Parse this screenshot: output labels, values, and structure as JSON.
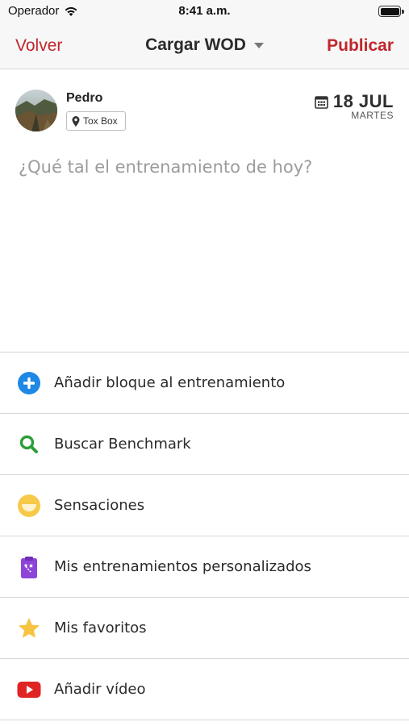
{
  "status_bar": {
    "carrier": "Operador",
    "time": "8:41 a.m."
  },
  "nav": {
    "back_label": "Volver",
    "title": "Cargar WOD",
    "publish_label": "Publicar"
  },
  "post": {
    "user_name": "Pedro",
    "place": "Tox Box",
    "date": "18 JUL",
    "weekday": "MARTES",
    "placeholder": "¿Qué tal el entrenamiento de hoy?"
  },
  "options": [
    {
      "label": "Añadir bloque al entrenamiento",
      "icon": "plus-circle-icon",
      "color": "#1e88e5"
    },
    {
      "label": "Buscar Benchmark",
      "icon": "magnifier-icon",
      "color": "#2e9e38"
    },
    {
      "label": "Sensaciones",
      "icon": "smiley-icon",
      "color": "#f7c948"
    },
    {
      "label": "Mis entrenamientos personalizados",
      "icon": "clipboard-icon",
      "color": "#8e44d9"
    },
    {
      "label": "Mis favoritos",
      "icon": "star-icon",
      "color": "#f6c343"
    },
    {
      "label": "Añadir vídeo",
      "icon": "youtube-icon",
      "color": "#e02424"
    }
  ],
  "colors": {
    "accent": "#c0272d",
    "nav_background": "#f7f7f7",
    "divider": "#d6d6d6"
  }
}
